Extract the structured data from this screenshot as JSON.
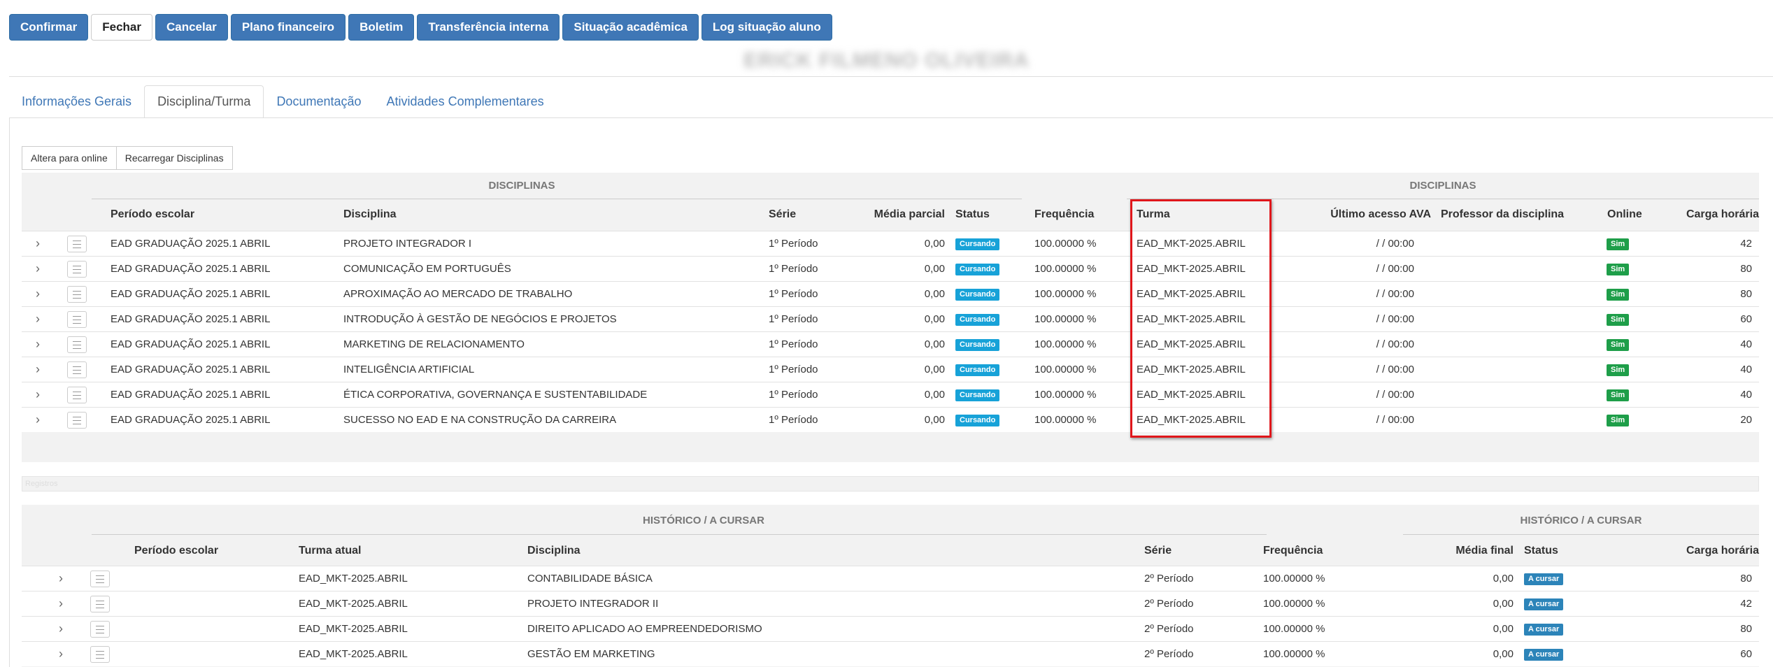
{
  "toolbar": {
    "buttons": [
      "Confirmar",
      "Fechar",
      "Cancelar",
      "Plano financeiro",
      "Boletim",
      "Transferência interna",
      "Situação acadêmica",
      "Log situação aluno"
    ]
  },
  "student": {
    "name": "ERICK FILMENO OLIVEIRA"
  },
  "tabs": [
    "Informações Gerais",
    "Disciplina/Turma",
    "Documentação",
    "Atividades Complementares"
  ],
  "subtoolbar": {
    "online_label": "Altera para online",
    "reload_label": "Recarregar Disciplinas"
  },
  "disciplinas": {
    "group_left": "DISCIPLINAS",
    "group_right": "DISCIPLINAS",
    "headers": {
      "periodo": "Período escolar",
      "disciplina": "Disciplina",
      "serie": "Série",
      "media": "Média parcial",
      "status": "Status",
      "frequencia": "Frequência",
      "turma": "Turma",
      "ultimo": "Último acesso AVA",
      "professor": "Professor da disciplina",
      "online": "Online",
      "carga": "Carga horária"
    },
    "rows": [
      {
        "periodo": "EAD GRADUAÇÃO 2025.1 ABRIL",
        "disciplina": "PROJETO INTEGRADOR I",
        "serie": "1º Período",
        "media": "0,00",
        "status": "Cursando",
        "frequencia": "100.00000 %",
        "turma": "EAD_MKT-2025.ABRIL",
        "ultimo": "/ / 00:00",
        "professor": "",
        "online": "Sim",
        "carga": "42"
      },
      {
        "periodo": "EAD GRADUAÇÃO 2025.1 ABRIL",
        "disciplina": "COMUNICAÇÃO EM PORTUGUÊS",
        "serie": "1º Período",
        "media": "0,00",
        "status": "Cursando",
        "frequencia": "100.00000 %",
        "turma": "EAD_MKT-2025.ABRIL",
        "ultimo": "/ / 00:00",
        "professor": "",
        "online": "Sim",
        "carga": "80"
      },
      {
        "periodo": "EAD GRADUAÇÃO 2025.1 ABRIL",
        "disciplina": "APROXIMAÇÃO AO MERCADO DE TRABALHO",
        "serie": "1º Período",
        "media": "0,00",
        "status": "Cursando",
        "frequencia": "100.00000 %",
        "turma": "EAD_MKT-2025.ABRIL",
        "ultimo": "/ / 00:00",
        "professor": "",
        "online": "Sim",
        "carga": "80"
      },
      {
        "periodo": "EAD GRADUAÇÃO 2025.1 ABRIL",
        "disciplina": "INTRODUÇÃO À GESTÃO DE NEGÓCIOS E PROJETOS",
        "serie": "1º Período",
        "media": "0,00",
        "status": "Cursando",
        "frequencia": "100.00000 %",
        "turma": "EAD_MKT-2025.ABRIL",
        "ultimo": "/ / 00:00",
        "professor": "",
        "online": "Sim",
        "carga": "60"
      },
      {
        "periodo": "EAD GRADUAÇÃO 2025.1 ABRIL",
        "disciplina": "MARKETING DE RELACIONAMENTO",
        "serie": "1º Período",
        "media": "0,00",
        "status": "Cursando",
        "frequencia": "100.00000 %",
        "turma": "EAD_MKT-2025.ABRIL",
        "ultimo": "/ / 00:00",
        "professor": "",
        "online": "Sim",
        "carga": "40"
      },
      {
        "periodo": "EAD GRADUAÇÃO 2025.1 ABRIL",
        "disciplina": "INTELIGÊNCIA ARTIFICIAL",
        "serie": "1º Período",
        "media": "0,00",
        "status": "Cursando",
        "frequencia": "100.00000 %",
        "turma": "EAD_MKT-2025.ABRIL",
        "ultimo": "/ / 00:00",
        "professor": "",
        "online": "Sim",
        "carga": "40"
      },
      {
        "periodo": "EAD GRADUAÇÃO 2025.1 ABRIL",
        "disciplina": "ÉTICA CORPORATIVA, GOVERNANÇA E SUSTENTABILIDADE",
        "serie": "1º Período",
        "media": "0,00",
        "status": "Cursando",
        "frequencia": "100.00000 %",
        "turma": "EAD_MKT-2025.ABRIL",
        "ultimo": "/ / 00:00",
        "professor": "",
        "online": "Sim",
        "carga": "40"
      },
      {
        "periodo": "EAD GRADUAÇÃO 2025.1 ABRIL",
        "disciplina": "SUCESSO NO EAD E NA CONSTRUÇÃO DA CARREIRA",
        "serie": "1º Período",
        "media": "0,00",
        "status": "Cursando",
        "frequencia": "100.00000 %",
        "turma": "EAD_MKT-2025.ABRIL",
        "ultimo": "/ / 00:00",
        "professor": "",
        "online": "Sim",
        "carga": "20"
      }
    ],
    "pager_text": "Registros"
  },
  "historico": {
    "group_left": "HISTÓRICO / A CURSAR",
    "group_right": "HISTÓRICO / A CURSAR",
    "headers": {
      "periodo": "Período escolar",
      "turma": "Turma atual",
      "disciplina": "Disciplina",
      "serie": "Série",
      "frequencia": "Frequência",
      "media": "Média final",
      "status": "Status",
      "carga": "Carga horária"
    },
    "rows": [
      {
        "periodo": "",
        "turma": "EAD_MKT-2025.ABRIL",
        "disciplina": "CONTABILIDADE BÁSICA",
        "serie": "2º Período",
        "frequencia": "100.00000 %",
        "media": "0,00",
        "status": "A cursar",
        "carga": "80"
      },
      {
        "periodo": "",
        "turma": "EAD_MKT-2025.ABRIL",
        "disciplina": "PROJETO INTEGRADOR II",
        "serie": "2º Período",
        "frequencia": "100.00000 %",
        "media": "0,00",
        "status": "A cursar",
        "carga": "42"
      },
      {
        "periodo": "",
        "turma": "EAD_MKT-2025.ABRIL",
        "disciplina": "DIREITO APLICADO AO EMPREENDEDORISMO",
        "serie": "2º Período",
        "frequencia": "100.00000 %",
        "media": "0,00",
        "status": "A cursar",
        "carga": "80"
      },
      {
        "periodo": "",
        "turma": "EAD_MKT-2025.ABRIL",
        "disciplina": "GESTÃO EM MARKETING",
        "serie": "2º Período",
        "frequencia": "100.00000 %",
        "media": "0,00",
        "status": "A cursar",
        "carga": "60"
      }
    ]
  }
}
